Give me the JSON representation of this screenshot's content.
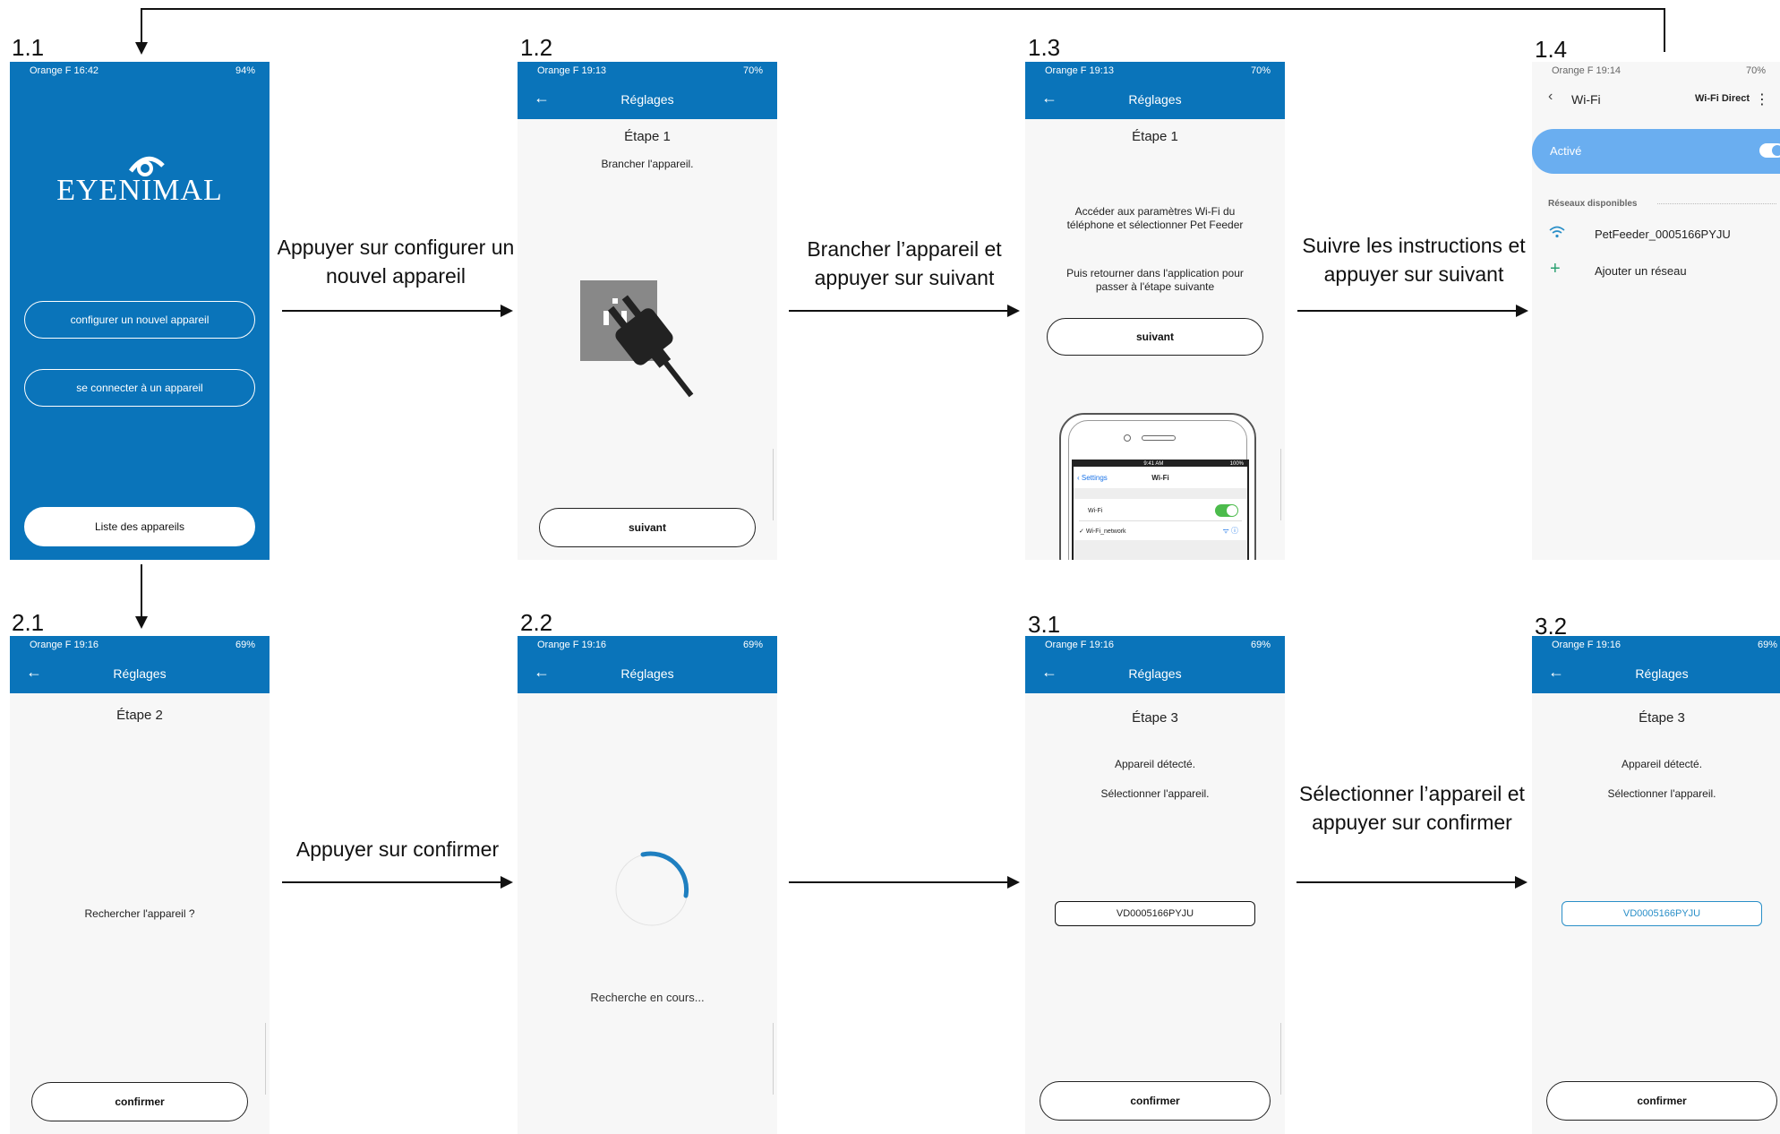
{
  "steps": {
    "s11": "1.1",
    "s12": "1.2",
    "s13": "1.3",
    "s14": "1.4",
    "s21": "2.1",
    "s22": "2.2",
    "s31": "3.1",
    "s32": "3.2"
  },
  "captions": {
    "c1": "Appuyer sur configurer un nouvel appareil",
    "c2": "Brancher l’appareil et appuyer sur suivant",
    "c3": "Suivre les instructions et appuyer sur suivant",
    "c4": "Appuyer sur confirmer",
    "c5": "Sélectionner l’appareil et appuyer sur confirmer"
  },
  "screen11": {
    "status_left": "Orange F 16:42",
    "status_right": "94%",
    "logo": "EYENIMAL",
    "btn_configure": "configurer un nouvel appareil",
    "btn_connect": "se connecter à un appareil",
    "btn_list": "Liste des appareils"
  },
  "screen12": {
    "status_left": "Orange F 19:13",
    "status_right": "70%",
    "title": "Réglages",
    "step": "Étape 1",
    "text": "Brancher l'appareil.",
    "btn": "suivant"
  },
  "screen13": {
    "status_left": "Orange F 19:13",
    "status_right": "70%",
    "title": "Réglages",
    "step": "Étape 1",
    "text1": "Accéder aux paramètres Wi-Fi du téléphone et sélectionner Pet Feeder",
    "text2": "Puis retourner dans l'application pour passer à l'étape suivante",
    "btn": "suivant",
    "phone_time": "9:41 AM",
    "phone_battery": "100%",
    "phone_back": "Settings",
    "phone_title": "Wi-Fi",
    "phone_wifi": "Wi-Fi",
    "phone_network": "Wi-Fi_network"
  },
  "screen14": {
    "status_left": "Orange F 19:14",
    "status_right": "70%",
    "title": "Wi-Fi",
    "direct": "Wi-Fi Direct",
    "active": "Activé",
    "section": "Réseaux disponibles",
    "network": "PetFeeder_0005166PYJU",
    "add": "Ajouter un réseau"
  },
  "screen21": {
    "status_left": "Orange F 19:16",
    "status_right": "69%",
    "title": "Réglages",
    "step": "Étape 2",
    "text": "Rechercher l'appareil ?",
    "btn": "confirmer"
  },
  "screen22": {
    "status_left": "Orange F 19:16",
    "status_right": "69%",
    "title": "Réglages",
    "text": "Recherche en cours..."
  },
  "screen31": {
    "status_left": "Orange F 19:16",
    "status_right": "69%",
    "title": "Réglages",
    "step": "Étape 3",
    "text1": "Appareil détecté.",
    "text2": "Sélectionner l'appareil.",
    "device": "VD0005166PYJU",
    "btn": "confirmer"
  },
  "screen32": {
    "status_left": "Orange F 19:16",
    "status_right": "69%",
    "title": "Réglages",
    "step": "Étape 3",
    "text1": "Appareil détecté.",
    "text2": "Sélectionner l'appareil.",
    "device": "VD0005166PYJU",
    "btn": "confirmer"
  },
  "colors": {
    "brand_blue": "#0a74ba",
    "toggle_blue": "#6aaef0",
    "selected_border": "#2a8fc8"
  }
}
